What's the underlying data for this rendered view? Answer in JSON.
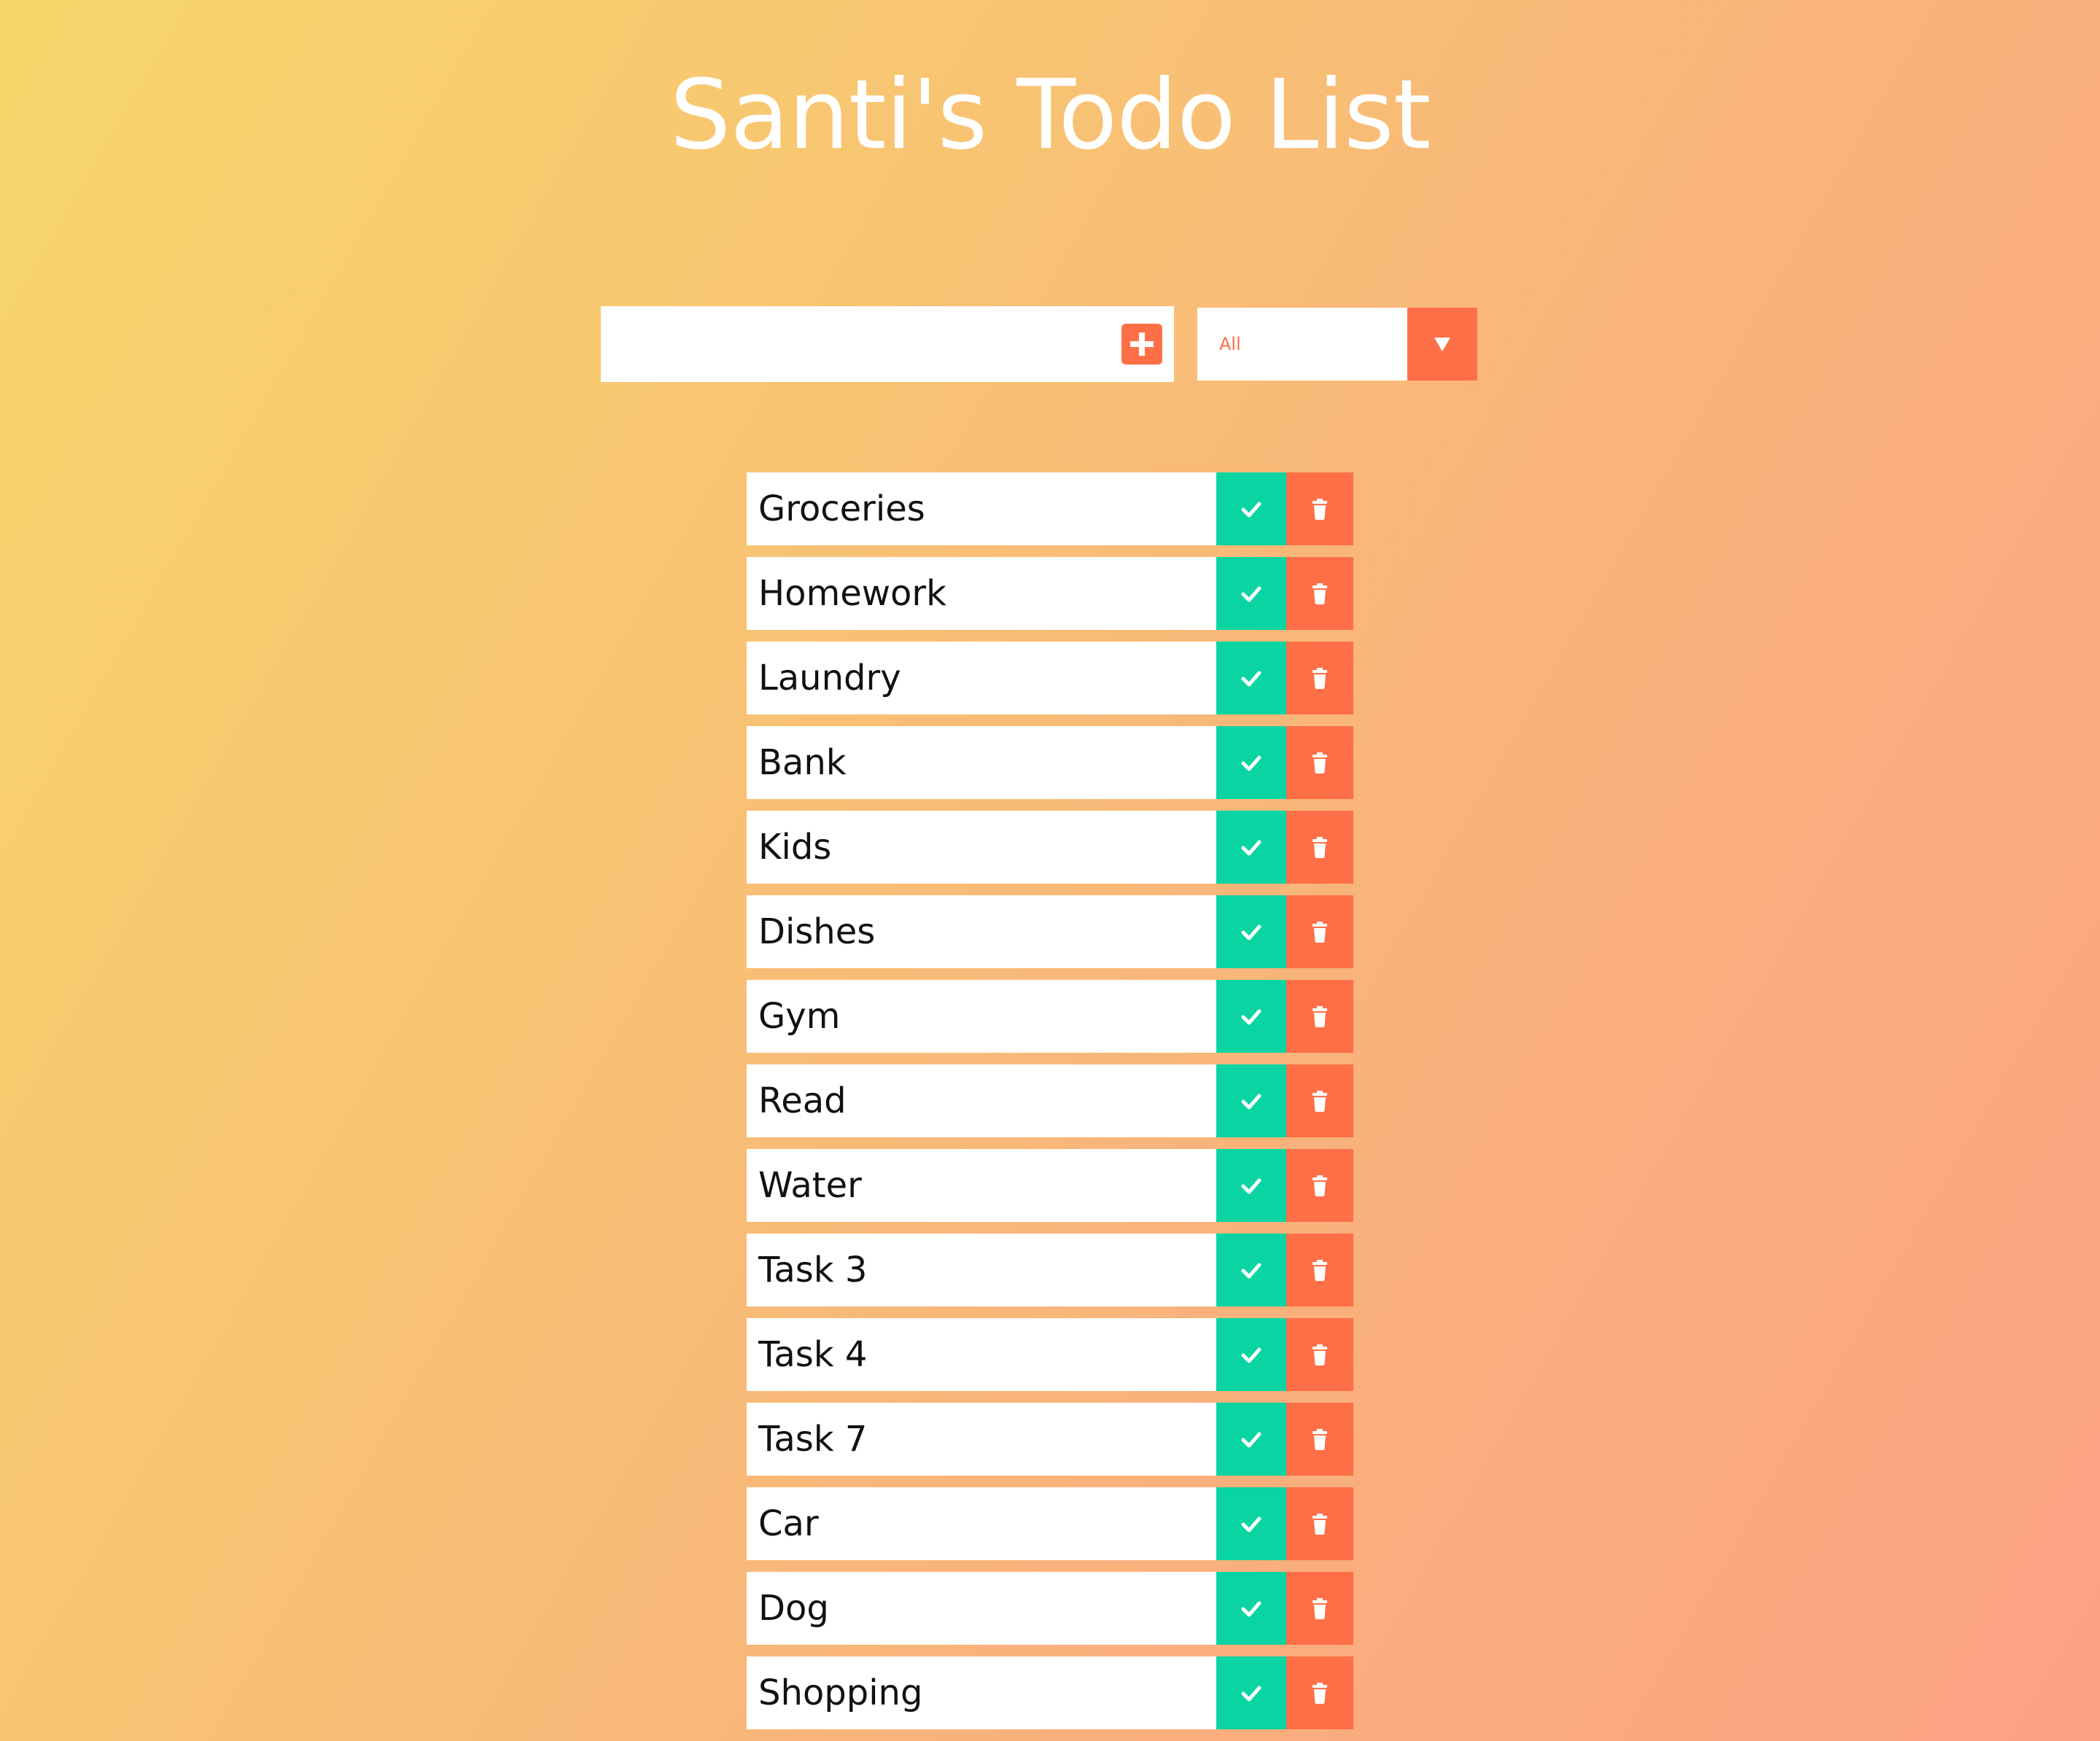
{
  "header": {
    "title": "Santi's Todo List"
  },
  "form": {
    "input_value": "",
    "input_placeholder": "",
    "add_icon": "plus-square-icon",
    "filter_selected": "All",
    "filter_icon": "caret-down-icon"
  },
  "todos": [
    {
      "label": "Groceries"
    },
    {
      "label": "Homework"
    },
    {
      "label": "Laundry"
    },
    {
      "label": "Bank"
    },
    {
      "label": "Kids"
    },
    {
      "label": "Dishes"
    },
    {
      "label": "Gym"
    },
    {
      "label": "Read"
    },
    {
      "label": "Water"
    },
    {
      "label": "Task 3"
    },
    {
      "label": "Task 4"
    },
    {
      "label": "Task 7"
    },
    {
      "label": "Car"
    },
    {
      "label": "Dog"
    },
    {
      "label": "Shopping"
    }
  ],
  "icons": {
    "complete": "check-icon",
    "delete": "trash-icon"
  },
  "colors": {
    "accent": "#ff6f47",
    "complete": "#0ad5a2",
    "gradient_start": "#f7d66a",
    "gradient_end": "#fca284"
  }
}
